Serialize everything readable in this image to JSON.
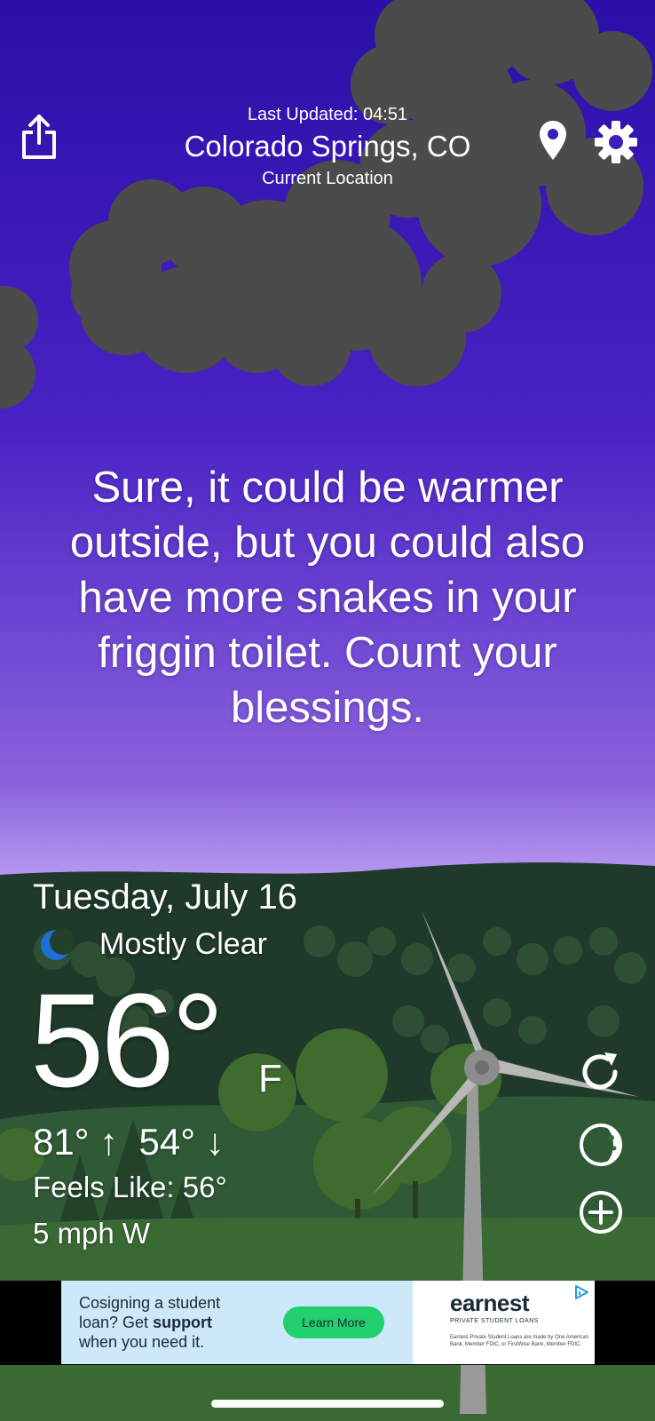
{
  "header": {
    "last_updated": "Last Updated: 04:51",
    "location": "Colorado Springs, CO",
    "location_sub": "Current Location"
  },
  "quote": "Sure, it could be warmer outside, but you could also have more snakes in your friggin toilet. Count your blessings.",
  "weather": {
    "date": "Tuesday, July 16",
    "condition": "Mostly Clear",
    "temperature": "56°",
    "unit": "F",
    "high_low": "81° ↑  54° ↓",
    "feels_like": "Feels Like: 56°",
    "wind": "5 mph W"
  },
  "ad": {
    "line1": "Cosigning a student",
    "line2": "loan? Get ",
    "line2_bold": "support",
    "line3": "when you need it.",
    "cta": "Learn More",
    "brand": "earnest",
    "tagline": "PRIVATE STUDENT LOANS",
    "fine_print": "Earnest Private Student Loans are made by One American Bank, Member FDIC, or FirstWise Bank, Member FDIC."
  },
  "icons": {
    "share": "share-icon",
    "location": "location-pin-icon",
    "settings": "gear-icon",
    "condition": "moon-icon",
    "refresh": "refresh-icon",
    "theme": "moon-phase-icon",
    "add": "plus-circle-icon",
    "adchoices": "adchoices-icon"
  },
  "colors": {
    "sky_top": "#2a0fa8",
    "sky_bottom": "#c4a8f4",
    "hills": "#1f3a2a",
    "clouds": "#4a4a4a",
    "ad_cta": "#22d16e"
  }
}
